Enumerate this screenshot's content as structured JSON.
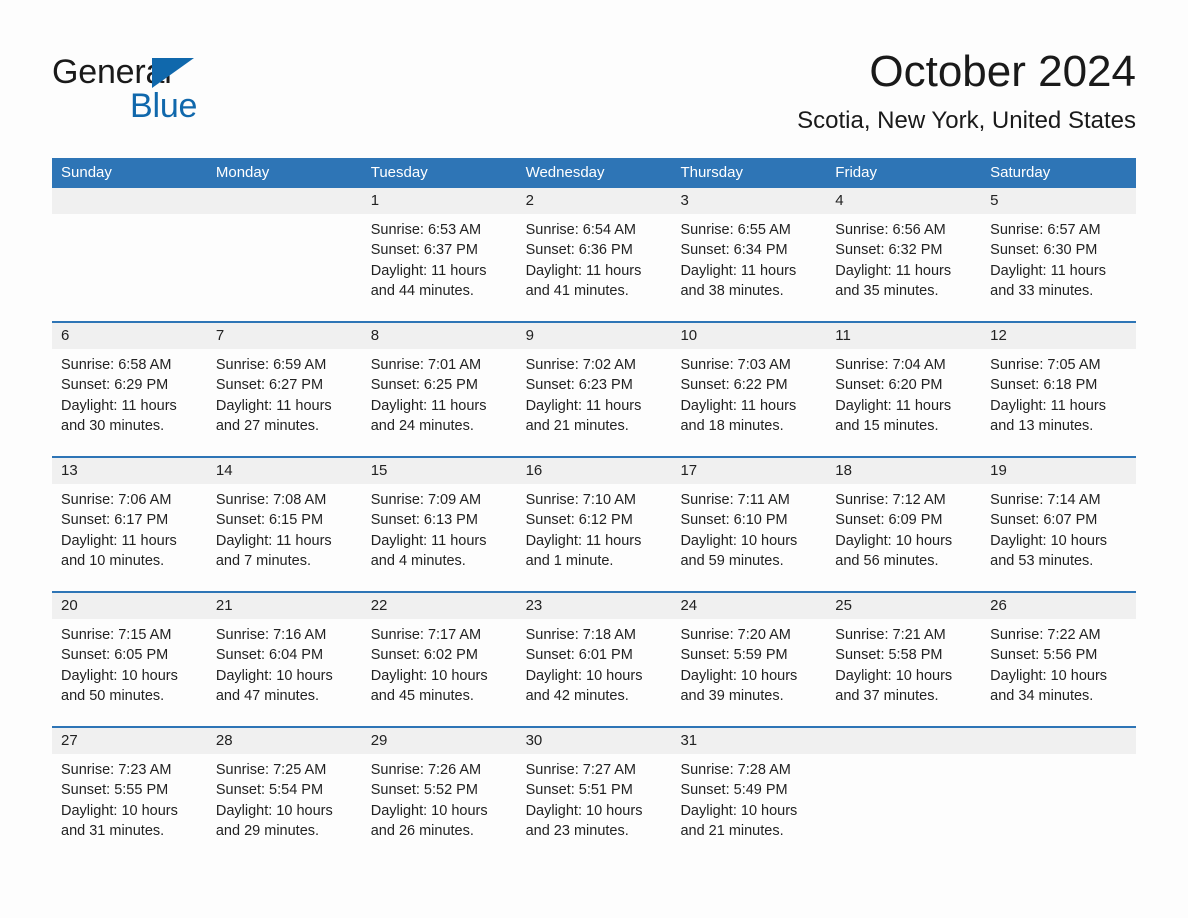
{
  "brand": {
    "name_part1": "General",
    "name_part2": "Blue",
    "triangle_color": "#1068ac"
  },
  "header": {
    "title": "October 2024",
    "location": "Scotia, New York, United States"
  },
  "calendar": {
    "header_bg": "#2e75b6",
    "daynum_bg": "#f0f0f0",
    "weekdays": [
      "Sunday",
      "Monday",
      "Tuesday",
      "Wednesday",
      "Thursday",
      "Friday",
      "Saturday"
    ],
    "weeks": [
      [
        {
          "day": "",
          "sunrise": "",
          "sunset": "",
          "daylight": "",
          "daylight2": ""
        },
        {
          "day": "",
          "sunrise": "",
          "sunset": "",
          "daylight": "",
          "daylight2": ""
        },
        {
          "day": "1",
          "sunrise": "Sunrise: 6:53 AM",
          "sunset": "Sunset: 6:37 PM",
          "daylight": "Daylight: 11 hours",
          "daylight2": "and 44 minutes."
        },
        {
          "day": "2",
          "sunrise": "Sunrise: 6:54 AM",
          "sunset": "Sunset: 6:36 PM",
          "daylight": "Daylight: 11 hours",
          "daylight2": "and 41 minutes."
        },
        {
          "day": "3",
          "sunrise": "Sunrise: 6:55 AM",
          "sunset": "Sunset: 6:34 PM",
          "daylight": "Daylight: 11 hours",
          "daylight2": "and 38 minutes."
        },
        {
          "day": "4",
          "sunrise": "Sunrise: 6:56 AM",
          "sunset": "Sunset: 6:32 PM",
          "daylight": "Daylight: 11 hours",
          "daylight2": "and 35 minutes."
        },
        {
          "day": "5",
          "sunrise": "Sunrise: 6:57 AM",
          "sunset": "Sunset: 6:30 PM",
          "daylight": "Daylight: 11 hours",
          "daylight2": "and 33 minutes."
        }
      ],
      [
        {
          "day": "6",
          "sunrise": "Sunrise: 6:58 AM",
          "sunset": "Sunset: 6:29 PM",
          "daylight": "Daylight: 11 hours",
          "daylight2": "and 30 minutes."
        },
        {
          "day": "7",
          "sunrise": "Sunrise: 6:59 AM",
          "sunset": "Sunset: 6:27 PM",
          "daylight": "Daylight: 11 hours",
          "daylight2": "and 27 minutes."
        },
        {
          "day": "8",
          "sunrise": "Sunrise: 7:01 AM",
          "sunset": "Sunset: 6:25 PM",
          "daylight": "Daylight: 11 hours",
          "daylight2": "and 24 minutes."
        },
        {
          "day": "9",
          "sunrise": "Sunrise: 7:02 AM",
          "sunset": "Sunset: 6:23 PM",
          "daylight": "Daylight: 11 hours",
          "daylight2": "and 21 minutes."
        },
        {
          "day": "10",
          "sunrise": "Sunrise: 7:03 AM",
          "sunset": "Sunset: 6:22 PM",
          "daylight": "Daylight: 11 hours",
          "daylight2": "and 18 minutes."
        },
        {
          "day": "11",
          "sunrise": "Sunrise: 7:04 AM",
          "sunset": "Sunset: 6:20 PM",
          "daylight": "Daylight: 11 hours",
          "daylight2": "and 15 minutes."
        },
        {
          "day": "12",
          "sunrise": "Sunrise: 7:05 AM",
          "sunset": "Sunset: 6:18 PM",
          "daylight": "Daylight: 11 hours",
          "daylight2": "and 13 minutes."
        }
      ],
      [
        {
          "day": "13",
          "sunrise": "Sunrise: 7:06 AM",
          "sunset": "Sunset: 6:17 PM",
          "daylight": "Daylight: 11 hours",
          "daylight2": "and 10 minutes."
        },
        {
          "day": "14",
          "sunrise": "Sunrise: 7:08 AM",
          "sunset": "Sunset: 6:15 PM",
          "daylight": "Daylight: 11 hours",
          "daylight2": "and 7 minutes."
        },
        {
          "day": "15",
          "sunrise": "Sunrise: 7:09 AM",
          "sunset": "Sunset: 6:13 PM",
          "daylight": "Daylight: 11 hours",
          "daylight2": "and 4 minutes."
        },
        {
          "day": "16",
          "sunrise": "Sunrise: 7:10 AM",
          "sunset": "Sunset: 6:12 PM",
          "daylight": "Daylight: 11 hours",
          "daylight2": "and 1 minute."
        },
        {
          "day": "17",
          "sunrise": "Sunrise: 7:11 AM",
          "sunset": "Sunset: 6:10 PM",
          "daylight": "Daylight: 10 hours",
          "daylight2": "and 59 minutes."
        },
        {
          "day": "18",
          "sunrise": "Sunrise: 7:12 AM",
          "sunset": "Sunset: 6:09 PM",
          "daylight": "Daylight: 10 hours",
          "daylight2": "and 56 minutes."
        },
        {
          "day": "19",
          "sunrise": "Sunrise: 7:14 AM",
          "sunset": "Sunset: 6:07 PM",
          "daylight": "Daylight: 10 hours",
          "daylight2": "and 53 minutes."
        }
      ],
      [
        {
          "day": "20",
          "sunrise": "Sunrise: 7:15 AM",
          "sunset": "Sunset: 6:05 PM",
          "daylight": "Daylight: 10 hours",
          "daylight2": "and 50 minutes."
        },
        {
          "day": "21",
          "sunrise": "Sunrise: 7:16 AM",
          "sunset": "Sunset: 6:04 PM",
          "daylight": "Daylight: 10 hours",
          "daylight2": "and 47 minutes."
        },
        {
          "day": "22",
          "sunrise": "Sunrise: 7:17 AM",
          "sunset": "Sunset: 6:02 PM",
          "daylight": "Daylight: 10 hours",
          "daylight2": "and 45 minutes."
        },
        {
          "day": "23",
          "sunrise": "Sunrise: 7:18 AM",
          "sunset": "Sunset: 6:01 PM",
          "daylight": "Daylight: 10 hours",
          "daylight2": "and 42 minutes."
        },
        {
          "day": "24",
          "sunrise": "Sunrise: 7:20 AM",
          "sunset": "Sunset: 5:59 PM",
          "daylight": "Daylight: 10 hours",
          "daylight2": "and 39 minutes."
        },
        {
          "day": "25",
          "sunrise": "Sunrise: 7:21 AM",
          "sunset": "Sunset: 5:58 PM",
          "daylight": "Daylight: 10 hours",
          "daylight2": "and 37 minutes."
        },
        {
          "day": "26",
          "sunrise": "Sunrise: 7:22 AM",
          "sunset": "Sunset: 5:56 PM",
          "daylight": "Daylight: 10 hours",
          "daylight2": "and 34 minutes."
        }
      ],
      [
        {
          "day": "27",
          "sunrise": "Sunrise: 7:23 AM",
          "sunset": "Sunset: 5:55 PM",
          "daylight": "Daylight: 10 hours",
          "daylight2": "and 31 minutes."
        },
        {
          "day": "28",
          "sunrise": "Sunrise: 7:25 AM",
          "sunset": "Sunset: 5:54 PM",
          "daylight": "Daylight: 10 hours",
          "daylight2": "and 29 minutes."
        },
        {
          "day": "29",
          "sunrise": "Sunrise: 7:26 AM",
          "sunset": "Sunset: 5:52 PM",
          "daylight": "Daylight: 10 hours",
          "daylight2": "and 26 minutes."
        },
        {
          "day": "30",
          "sunrise": "Sunrise: 7:27 AM",
          "sunset": "Sunset: 5:51 PM",
          "daylight": "Daylight: 10 hours",
          "daylight2": "and 23 minutes."
        },
        {
          "day": "31",
          "sunrise": "Sunrise: 7:28 AM",
          "sunset": "Sunset: 5:49 PM",
          "daylight": "Daylight: 10 hours",
          "daylight2": "and 21 minutes."
        },
        {
          "day": "",
          "sunrise": "",
          "sunset": "",
          "daylight": "",
          "daylight2": ""
        },
        {
          "day": "",
          "sunrise": "",
          "sunset": "",
          "daylight": "",
          "daylight2": ""
        }
      ]
    ]
  }
}
